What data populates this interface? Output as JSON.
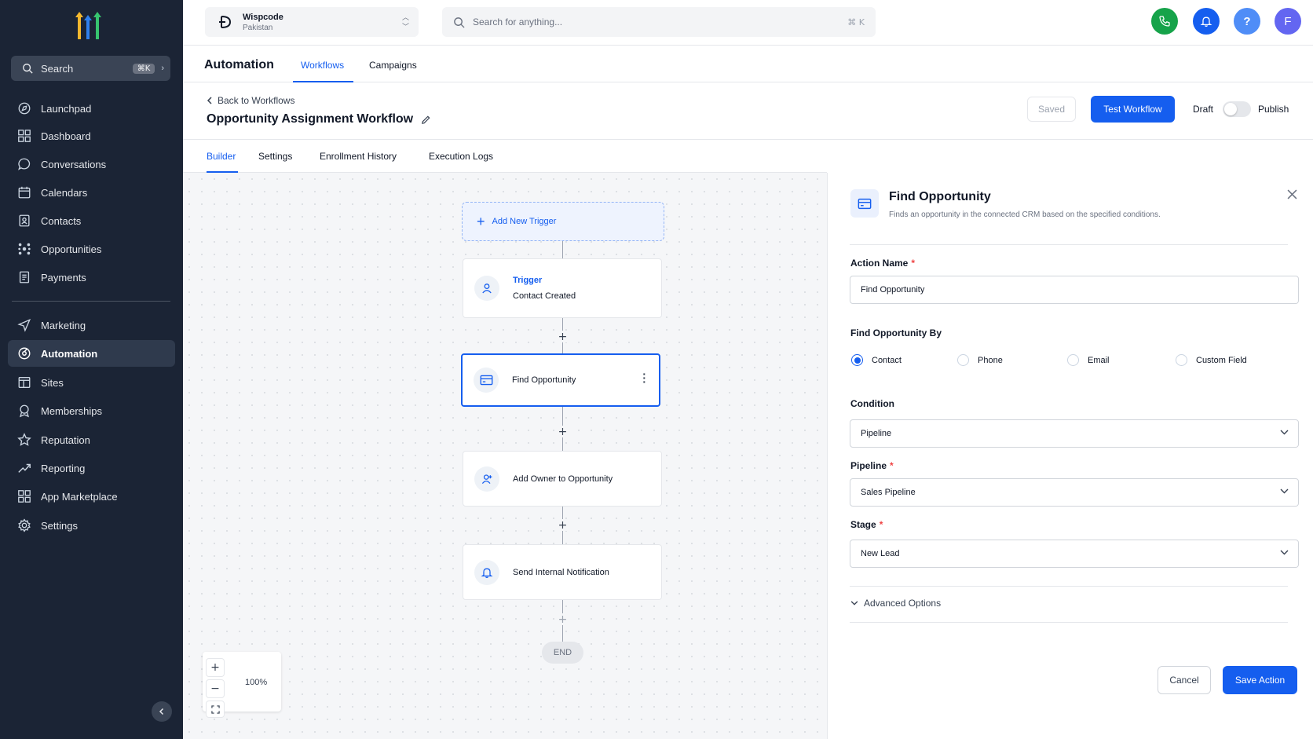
{
  "colors": {
    "accent": "#155eef",
    "sidebar_bg": "#1b2435",
    "phone": "#16a34a",
    "bell": "#155eef",
    "help": "#4f8df7",
    "avatar": "#6366f1"
  },
  "sidebar": {
    "search_label": "Search",
    "search_shortcut": "⌘K",
    "items": [
      {
        "label": "Launchpad",
        "icon": "rocket-icon"
      },
      {
        "label": "Dashboard",
        "icon": "grid-icon"
      },
      {
        "label": "Conversations",
        "icon": "chat-icon"
      },
      {
        "label": "Calendars",
        "icon": "calendar-icon"
      },
      {
        "label": "Contacts",
        "icon": "contacts-icon"
      },
      {
        "label": "Opportunities",
        "icon": "opportunities-icon"
      },
      {
        "label": "Payments",
        "icon": "receipt-icon"
      },
      {
        "label": "Marketing",
        "icon": "send-icon"
      },
      {
        "label": "Automation",
        "icon": "automation-icon",
        "active": true
      },
      {
        "label": "Sites",
        "icon": "sites-icon"
      },
      {
        "label": "Memberships",
        "icon": "membership-icon"
      },
      {
        "label": "Reputation",
        "icon": "star-icon"
      },
      {
        "label": "Reporting",
        "icon": "trend-icon"
      },
      {
        "label": "App Marketplace",
        "icon": "apps-icon"
      },
      {
        "label": "Settings",
        "icon": "gear-icon"
      }
    ]
  },
  "topbar": {
    "account_name": "Wispcode",
    "account_location": "Pakistan",
    "search_placeholder": "Search for anything...",
    "search_shortcut": "⌘ K",
    "avatar_initial": "F"
  },
  "module": {
    "title": "Automation",
    "tabs": [
      "Workflows",
      "Campaigns"
    ],
    "active_tab": "Workflows"
  },
  "workflow": {
    "back_label": "Back to Workflows",
    "title": "Opportunity Assignment Workflow",
    "saved_label": "Saved",
    "test_label": "Test Workflow",
    "draft_label": "Draft",
    "publish_label": "Publish",
    "published": false,
    "subtabs": [
      "Builder",
      "Settings",
      "Enrollment History",
      "Execution Logs"
    ],
    "active_subtab": "Builder"
  },
  "canvas": {
    "add_trigger_label": "Add New Trigger",
    "trigger": {
      "title": "Trigger",
      "subtitle": "Contact Created"
    },
    "nodes": [
      {
        "label": "Find Opportunity",
        "icon": "card-icon",
        "selected": true
      },
      {
        "label": "Add Owner to Opportunity",
        "icon": "user-plus-icon"
      },
      {
        "label": "Send Internal Notification",
        "icon": "bell-icon"
      }
    ],
    "end_label": "END",
    "zoom": "100%"
  },
  "panel": {
    "title": "Find Opportunity",
    "description": "Finds an opportunity in the connected CRM based on the specified conditions.",
    "action_name_label": "Action Name",
    "action_name_value": "Find Opportunity",
    "find_by_label": "Find Opportunity By",
    "find_by_options": [
      "Contact",
      "Phone",
      "Email",
      "Custom Field"
    ],
    "find_by_selected": "Contact",
    "condition_label": "Condition",
    "condition_value": "Pipeline",
    "pipeline_label": "Pipeline",
    "pipeline_value": "Sales Pipeline",
    "stage_label": "Stage",
    "stage_value": "New Lead",
    "advanced_label": "Advanced Options",
    "cancel_label": "Cancel",
    "save_label": "Save Action"
  }
}
